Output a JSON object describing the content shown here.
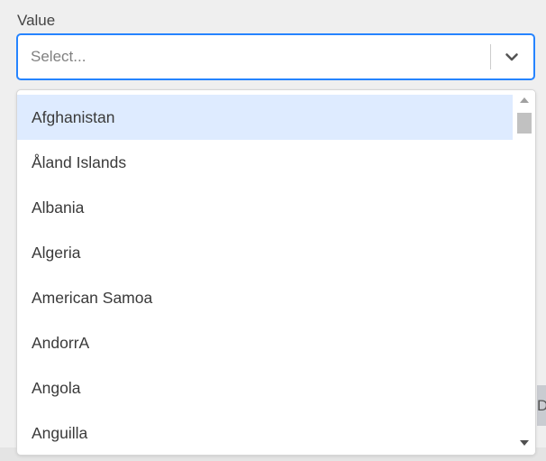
{
  "field": {
    "label": "Value",
    "placeholder": "Select..."
  },
  "menu": {
    "options": [
      "Afghanistan",
      "Åland Islands",
      "Albania",
      "Algeria",
      "American Samoa",
      "AndorrA",
      "Angola",
      "Anguilla"
    ],
    "focused_option": "Afghanistan"
  },
  "background": {
    "partial_button_text": "D"
  },
  "colors": {
    "focus_border": "#2684ff",
    "option_focus": "#deebff"
  },
  "icons": {
    "dropdown": "chevron-down-icon",
    "scroll_up": "scroll-up-arrow-icon",
    "scroll_down": "scroll-down-arrow-icon"
  }
}
